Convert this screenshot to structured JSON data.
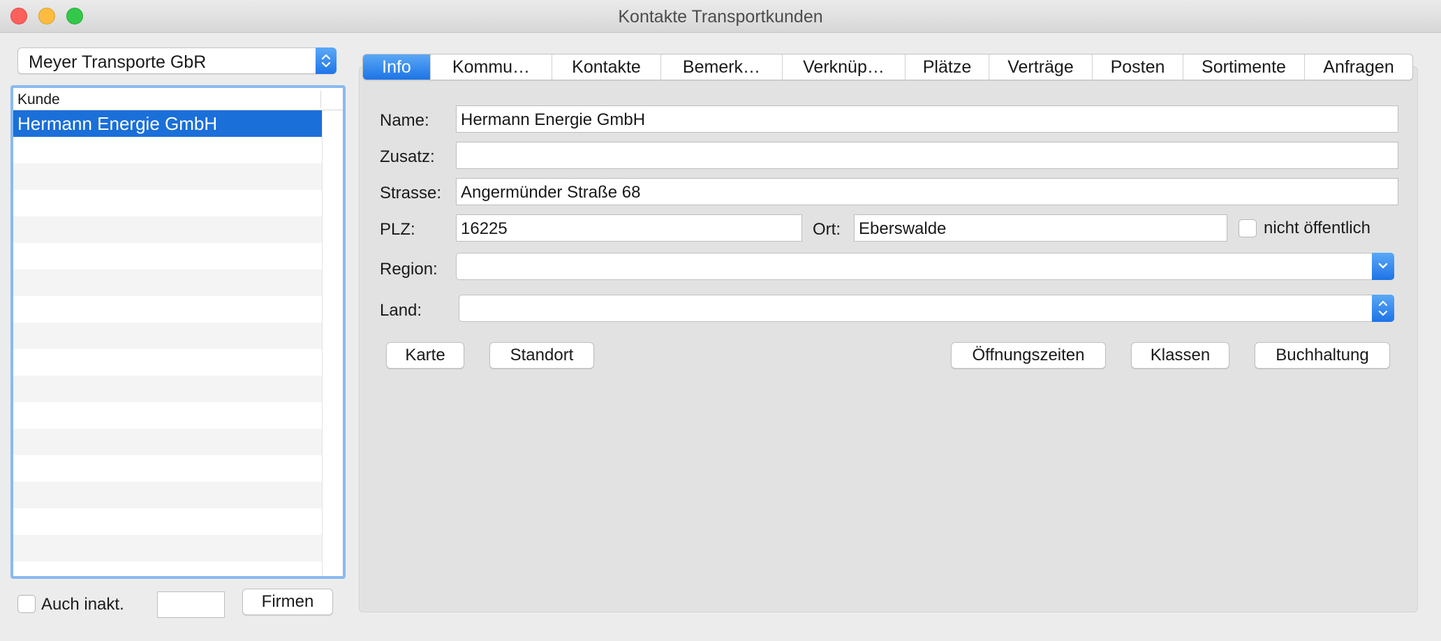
{
  "window": {
    "title": "Kontakte Transportkunden"
  },
  "company_select": {
    "value": "Meyer Transporte GbR"
  },
  "customer_list": {
    "header": "Kunde",
    "rows": [
      "Hermann Energie GmbH"
    ]
  },
  "bottom_left": {
    "inactive_label": "Auch inakt.",
    "filter_value": "",
    "companies_button": "Firmen"
  },
  "tabs": [
    {
      "label": "Info",
      "active": true
    },
    {
      "label": "Kommu…"
    },
    {
      "label": "Kontakte"
    },
    {
      "label": "Bemerk…"
    },
    {
      "label": "Verknüp…"
    },
    {
      "label": "Plätze"
    },
    {
      "label": "Verträge"
    },
    {
      "label": "Posten"
    },
    {
      "label": "Sortimente"
    },
    {
      "label": "Anfragen"
    }
  ],
  "form": {
    "name_label": "Name:",
    "name_value": "Hermann Energie GmbH",
    "suffix_label": "Zusatz:",
    "suffix_value": "",
    "street_label": "Strasse:",
    "street_value": "Angermünder Straße 68",
    "zip_label": "PLZ:",
    "zip_value": "16225",
    "city_label": "Ort:",
    "city_value": "Eberswalde",
    "not_public_label": "nicht öffentlich",
    "region_label": "Region:",
    "region_value": "",
    "country_label": "Land:",
    "country_value": ""
  },
  "actions": {
    "map": "Karte",
    "location": "Standort",
    "opening_hours": "Öffnungszeiten",
    "classes": "Klassen",
    "accounting": "Buchhaltung"
  },
  "colors": {
    "accent": "#1d74e6",
    "selection": "#1a6fd9",
    "list_focus_ring": "#8ab9f0",
    "window_bg": "#ececec",
    "panel_bg": "#e2e2e2"
  }
}
